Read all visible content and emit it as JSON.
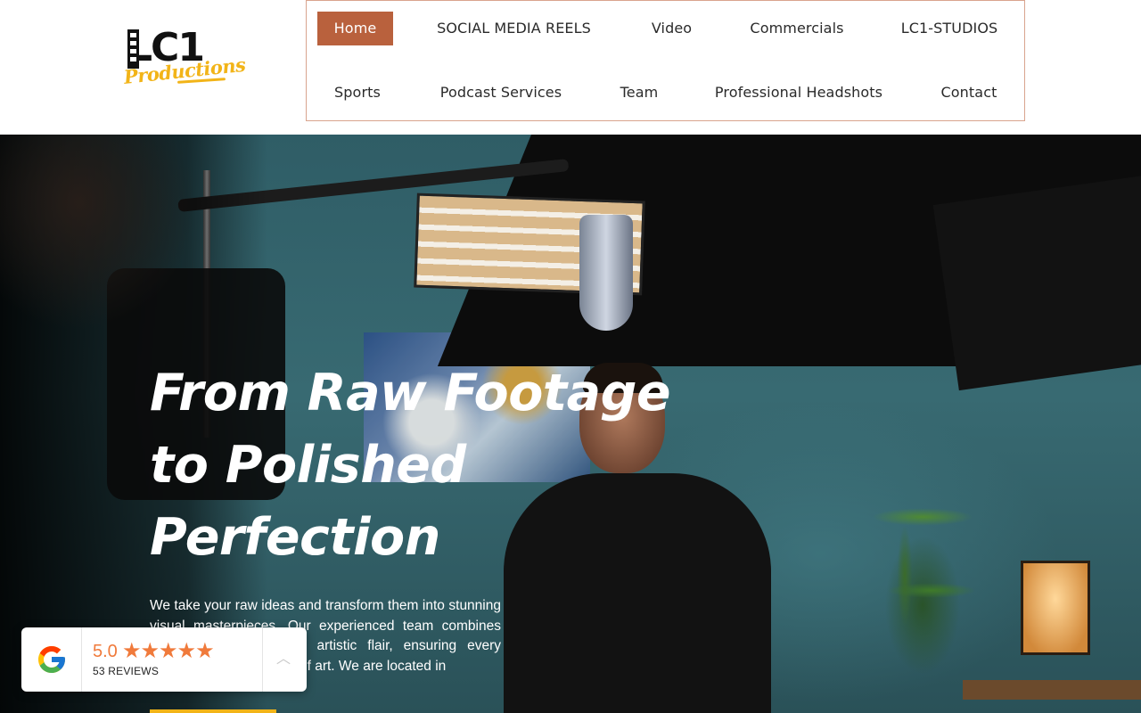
{
  "brand": {
    "logo_text": "LC1",
    "logo_script": "Productions"
  },
  "nav": {
    "items": [
      {
        "label": "Home",
        "active": true
      },
      {
        "label": "SOCIAL MEDIA REELS"
      },
      {
        "label": "Video"
      },
      {
        "label": "Commercials"
      },
      {
        "label": "LC1-STUDIOS"
      },
      {
        "label": "Sports"
      },
      {
        "label": "Podcast Services"
      },
      {
        "label": "Team"
      },
      {
        "label": "Professional Headshots"
      },
      {
        "label": "Contact"
      }
    ]
  },
  "hero": {
    "title_lines": [
      "From Raw Footage",
      "to Polished",
      "Perfection"
    ],
    "description": "We take your raw ideas and transform them into stunning visual masterpieces. Our experienced team combines technical expertise with artistic flair, ensuring every project becomes a work of art. We are located in"
  },
  "reviews": {
    "rating": "5.0",
    "stars": "★★★★★",
    "count_label": "53 REVIEWS"
  },
  "colors": {
    "accent": "#b9613d",
    "brand_yellow": "#f2b418",
    "star": "#f07a3b",
    "nav_border": "#d9a48e"
  },
  "icons": {
    "google": "google-g-logo",
    "chevron": "chevron-up-icon"
  }
}
